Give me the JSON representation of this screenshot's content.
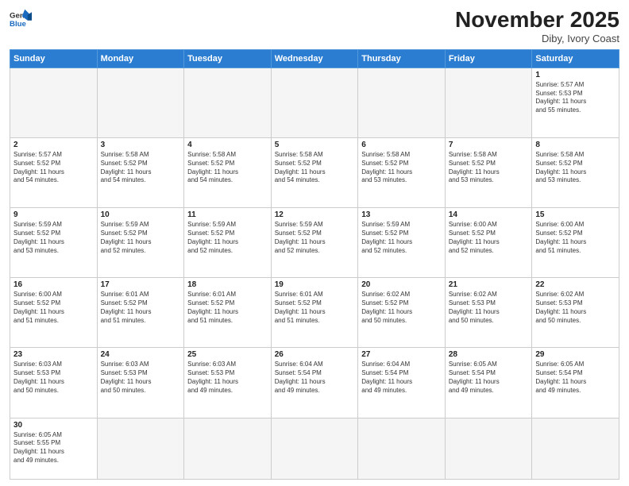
{
  "header": {
    "logo_general": "General",
    "logo_blue": "Blue",
    "month_title": "November 2025",
    "location": "Diby, Ivory Coast"
  },
  "weekdays": [
    "Sunday",
    "Monday",
    "Tuesday",
    "Wednesday",
    "Thursday",
    "Friday",
    "Saturday"
  ],
  "weeks": [
    [
      {
        "day": "",
        "info": ""
      },
      {
        "day": "",
        "info": ""
      },
      {
        "day": "",
        "info": ""
      },
      {
        "day": "",
        "info": ""
      },
      {
        "day": "",
        "info": ""
      },
      {
        "day": "",
        "info": ""
      },
      {
        "day": "1",
        "info": "Sunrise: 5:57 AM\nSunset: 5:53 PM\nDaylight: 11 hours\nand 55 minutes."
      }
    ],
    [
      {
        "day": "2",
        "info": "Sunrise: 5:57 AM\nSunset: 5:52 PM\nDaylight: 11 hours\nand 54 minutes."
      },
      {
        "day": "3",
        "info": "Sunrise: 5:58 AM\nSunset: 5:52 PM\nDaylight: 11 hours\nand 54 minutes."
      },
      {
        "day": "4",
        "info": "Sunrise: 5:58 AM\nSunset: 5:52 PM\nDaylight: 11 hours\nand 54 minutes."
      },
      {
        "day": "5",
        "info": "Sunrise: 5:58 AM\nSunset: 5:52 PM\nDaylight: 11 hours\nand 54 minutes."
      },
      {
        "day": "6",
        "info": "Sunrise: 5:58 AM\nSunset: 5:52 PM\nDaylight: 11 hours\nand 53 minutes."
      },
      {
        "day": "7",
        "info": "Sunrise: 5:58 AM\nSunset: 5:52 PM\nDaylight: 11 hours\nand 53 minutes."
      },
      {
        "day": "8",
        "info": "Sunrise: 5:58 AM\nSunset: 5:52 PM\nDaylight: 11 hours\nand 53 minutes."
      }
    ],
    [
      {
        "day": "9",
        "info": "Sunrise: 5:59 AM\nSunset: 5:52 PM\nDaylight: 11 hours\nand 53 minutes."
      },
      {
        "day": "10",
        "info": "Sunrise: 5:59 AM\nSunset: 5:52 PM\nDaylight: 11 hours\nand 52 minutes."
      },
      {
        "day": "11",
        "info": "Sunrise: 5:59 AM\nSunset: 5:52 PM\nDaylight: 11 hours\nand 52 minutes."
      },
      {
        "day": "12",
        "info": "Sunrise: 5:59 AM\nSunset: 5:52 PM\nDaylight: 11 hours\nand 52 minutes."
      },
      {
        "day": "13",
        "info": "Sunrise: 5:59 AM\nSunset: 5:52 PM\nDaylight: 11 hours\nand 52 minutes."
      },
      {
        "day": "14",
        "info": "Sunrise: 6:00 AM\nSunset: 5:52 PM\nDaylight: 11 hours\nand 52 minutes."
      },
      {
        "day": "15",
        "info": "Sunrise: 6:00 AM\nSunset: 5:52 PM\nDaylight: 11 hours\nand 51 minutes."
      }
    ],
    [
      {
        "day": "16",
        "info": "Sunrise: 6:00 AM\nSunset: 5:52 PM\nDaylight: 11 hours\nand 51 minutes."
      },
      {
        "day": "17",
        "info": "Sunrise: 6:01 AM\nSunset: 5:52 PM\nDaylight: 11 hours\nand 51 minutes."
      },
      {
        "day": "18",
        "info": "Sunrise: 6:01 AM\nSunset: 5:52 PM\nDaylight: 11 hours\nand 51 minutes."
      },
      {
        "day": "19",
        "info": "Sunrise: 6:01 AM\nSunset: 5:52 PM\nDaylight: 11 hours\nand 51 minutes."
      },
      {
        "day": "20",
        "info": "Sunrise: 6:02 AM\nSunset: 5:52 PM\nDaylight: 11 hours\nand 50 minutes."
      },
      {
        "day": "21",
        "info": "Sunrise: 6:02 AM\nSunset: 5:53 PM\nDaylight: 11 hours\nand 50 minutes."
      },
      {
        "day": "22",
        "info": "Sunrise: 6:02 AM\nSunset: 5:53 PM\nDaylight: 11 hours\nand 50 minutes."
      }
    ],
    [
      {
        "day": "23",
        "info": "Sunrise: 6:03 AM\nSunset: 5:53 PM\nDaylight: 11 hours\nand 50 minutes."
      },
      {
        "day": "24",
        "info": "Sunrise: 6:03 AM\nSunset: 5:53 PM\nDaylight: 11 hours\nand 50 minutes."
      },
      {
        "day": "25",
        "info": "Sunrise: 6:03 AM\nSunset: 5:53 PM\nDaylight: 11 hours\nand 49 minutes."
      },
      {
        "day": "26",
        "info": "Sunrise: 6:04 AM\nSunset: 5:54 PM\nDaylight: 11 hours\nand 49 minutes."
      },
      {
        "day": "27",
        "info": "Sunrise: 6:04 AM\nSunset: 5:54 PM\nDaylight: 11 hours\nand 49 minutes."
      },
      {
        "day": "28",
        "info": "Sunrise: 6:05 AM\nSunset: 5:54 PM\nDaylight: 11 hours\nand 49 minutes."
      },
      {
        "day": "29",
        "info": "Sunrise: 6:05 AM\nSunset: 5:54 PM\nDaylight: 11 hours\nand 49 minutes."
      }
    ],
    [
      {
        "day": "30",
        "info": "Sunrise: 6:05 AM\nSunset: 5:55 PM\nDaylight: 11 hours\nand 49 minutes."
      },
      {
        "day": "",
        "info": ""
      },
      {
        "day": "",
        "info": ""
      },
      {
        "day": "",
        "info": ""
      },
      {
        "day": "",
        "info": ""
      },
      {
        "day": "",
        "info": ""
      },
      {
        "day": "",
        "info": ""
      }
    ]
  ]
}
